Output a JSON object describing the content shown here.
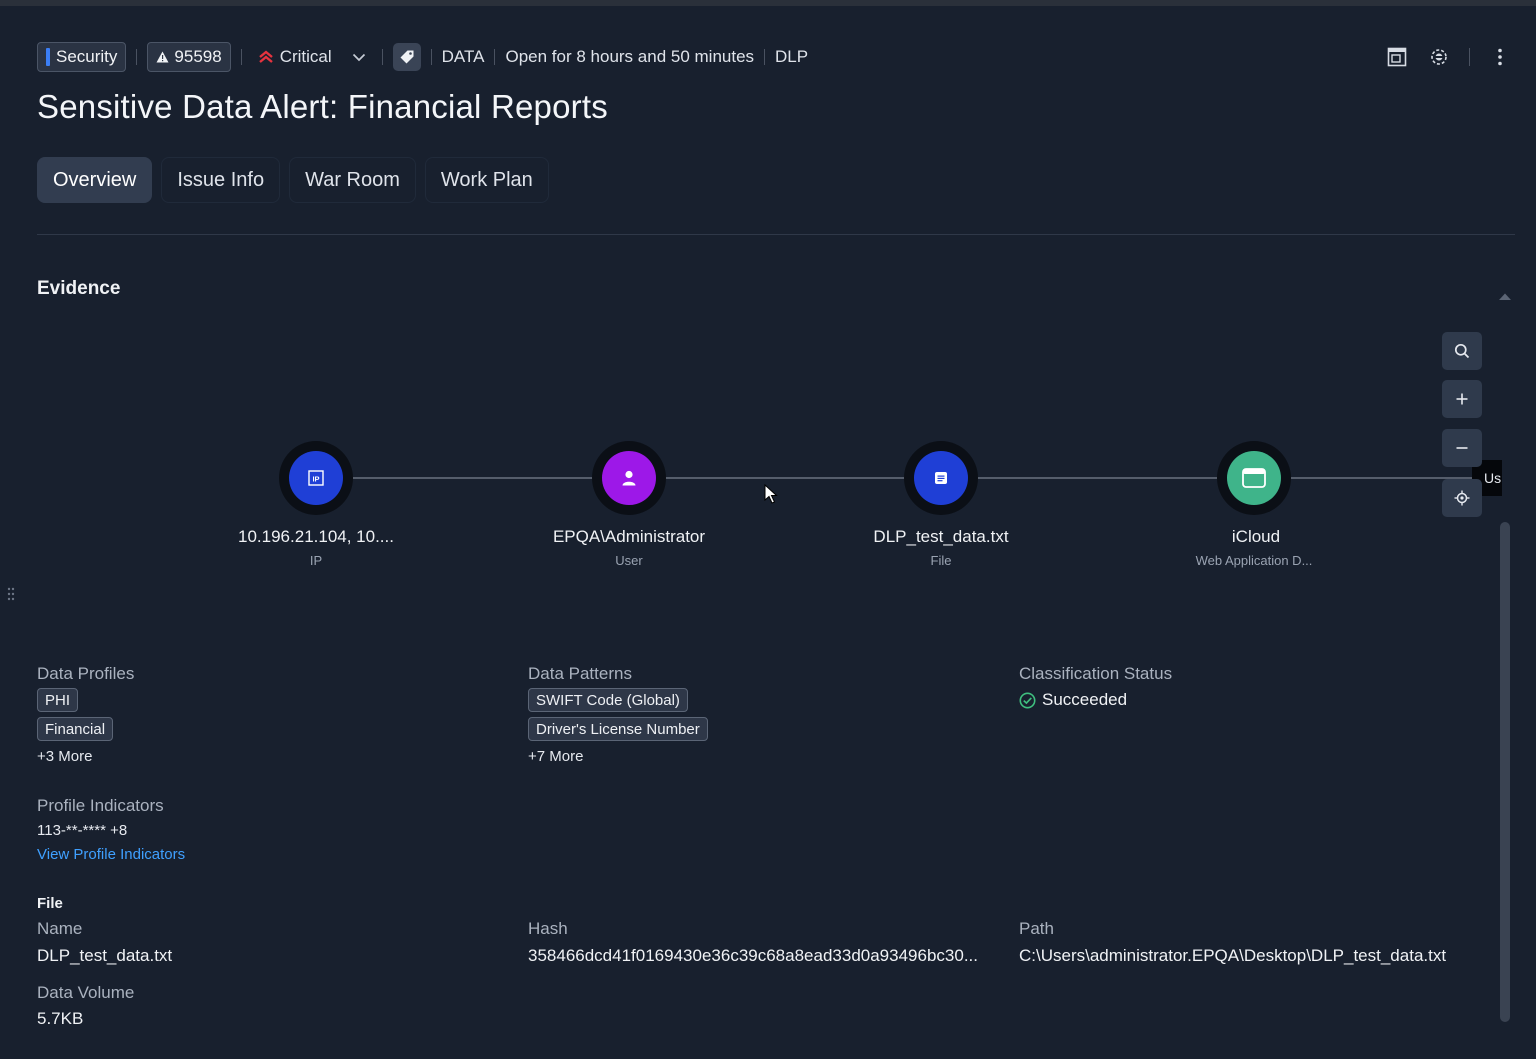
{
  "header": {
    "category": "Security",
    "issue_id": "95598",
    "severity": "Critical",
    "source_type": "DATA",
    "open_duration": "Open for 8 hours and 50 minutes",
    "module": "DLP",
    "title": "Sensitive Data Alert: Financial Reports"
  },
  "tabs": [
    {
      "label": "Overview",
      "active": true
    },
    {
      "label": "Issue Info",
      "active": false
    },
    {
      "label": "War Room",
      "active": false
    },
    {
      "label": "Work Plan",
      "active": false
    }
  ],
  "evidence": {
    "section_title": "Evidence",
    "nodes": [
      {
        "label": "10.196.21.104, 10....",
        "type": "IP",
        "color": "#1f3fd6",
        "icon": "ip-icon"
      },
      {
        "label": "EPQA\\Administrator",
        "type": "User",
        "color": "#9d18e8",
        "icon": "user-icon"
      },
      {
        "label": "DLP_test_data.txt",
        "type": "File",
        "color": "#1f3fd6",
        "icon": "file-icon"
      },
      {
        "label": "iCloud",
        "type": "Web Application D...",
        "color": "#3fb48a",
        "icon": "browser-window-icon"
      }
    ],
    "edge_tooltip": "Us"
  },
  "details": {
    "data_profiles_label": "Data Profiles",
    "data_profiles": [
      "PHI",
      "Financial"
    ],
    "data_profiles_more": "+3 More",
    "data_patterns_label": "Data Patterns",
    "data_patterns": [
      "SWIFT Code (Global)",
      "Driver's License Number"
    ],
    "data_patterns_more": "+7 More",
    "classification_status_label": "Classification Status",
    "classification_status": "Succeeded",
    "profile_indicators_label": "Profile Indicators",
    "profile_indicators_value": "113-**-**** +8",
    "view_profile_indicators": "View Profile Indicators",
    "file_section_label": "File",
    "name_label": "Name",
    "name_value": "DLP_test_data.txt",
    "hash_label": "Hash",
    "hash_value": "358466dcd41f0169430e36c39c68a8ead33d0a93496bc30...",
    "path_label": "Path",
    "path_value": "C:\\Users\\administrator.EPQA\\Desktop\\DLP_test_data.txt",
    "data_volume_label": "Data Volume",
    "data_volume_value": "5.7KB"
  },
  "colors": {
    "background": "#18202e",
    "accent_blue": "#3b7ef5",
    "critical_red": "#e5333f",
    "success_green": "#3fbf7f",
    "link_blue": "#3fa0ff"
  }
}
